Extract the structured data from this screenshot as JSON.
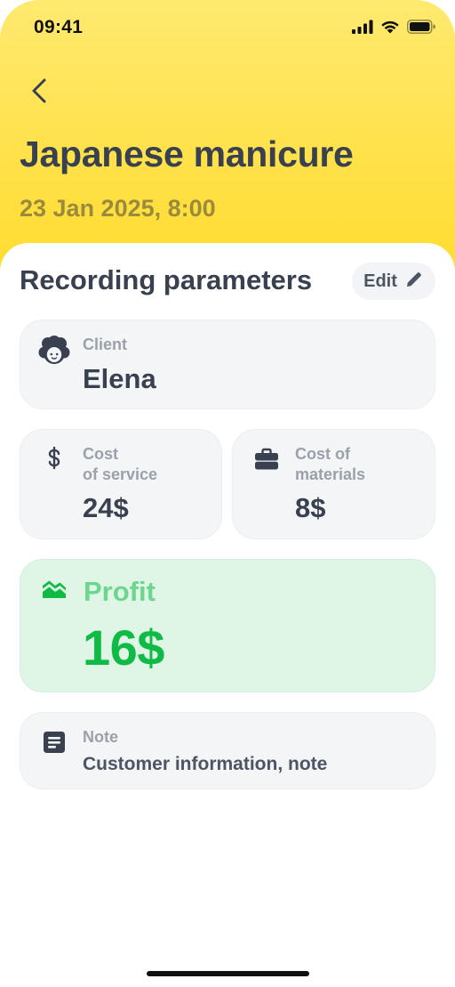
{
  "status_bar": {
    "time": "09:41"
  },
  "header": {
    "back_icon": "chevron-left-icon",
    "title": "Japanese manicure",
    "datetime": "23 Jan 2025, 8:00"
  },
  "section": {
    "title": "Recording parameters",
    "edit_label": "Edit",
    "edit_icon": "pencil-icon"
  },
  "client": {
    "icon": "client-avatar-icon",
    "label": "Client",
    "value": "Elena"
  },
  "cost_of_service": {
    "icon": "dollar-icon",
    "label_line1": "Cost",
    "label_line2": "of service",
    "value": "24$"
  },
  "cost_of_materials": {
    "icon": "briefcase-icon",
    "label_line1": "Cost of",
    "label_line2": "materials",
    "value": "8$"
  },
  "profit": {
    "icon": "chart-area-icon",
    "label": "Profit",
    "value": "16$"
  },
  "note": {
    "icon": "note-icon",
    "label": "Note",
    "value": "Customer information, note"
  },
  "colors": {
    "header_yellow": "#ffdc2e",
    "text_dark": "#394150",
    "date_muted": "#9c8a3c",
    "profit_bg": "#dff5e6",
    "profit_green": "#0fba45",
    "profit_label_green": "#6cd68e",
    "card_bg": "#f4f5f7"
  }
}
